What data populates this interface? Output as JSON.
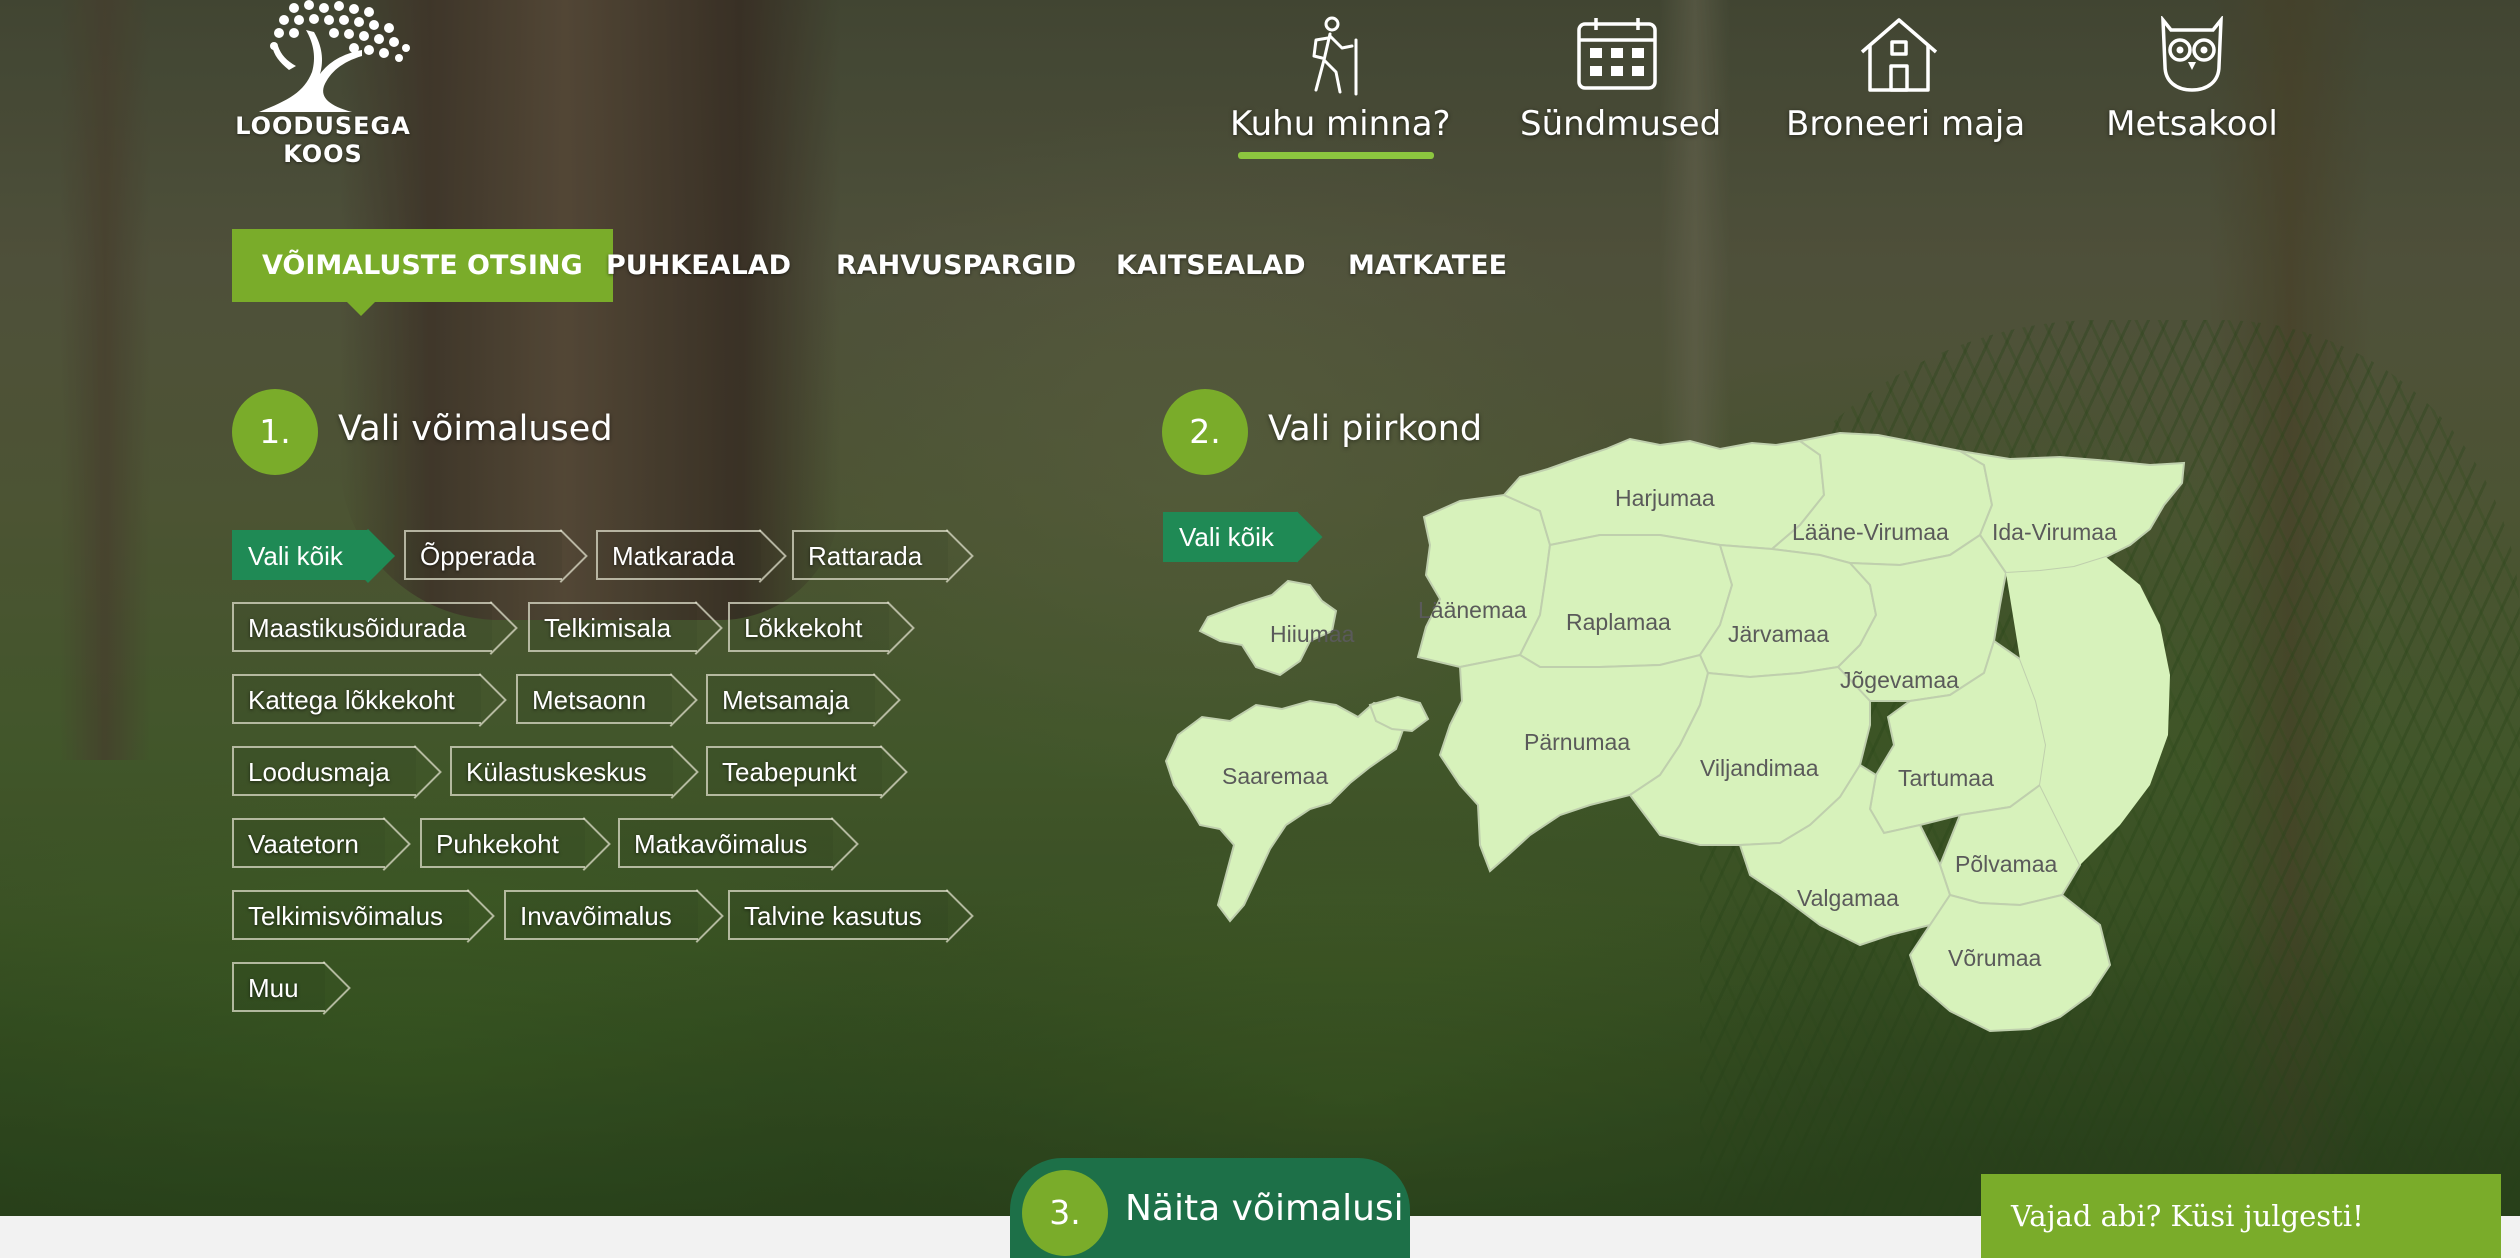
{
  "logo": {
    "line1": "LOODUSEGA",
    "line2": "KOOS"
  },
  "main_nav": [
    {
      "label": "Kuhu minna?",
      "icon": "hiker-icon",
      "active": true
    },
    {
      "label": "Sündmused",
      "icon": "calendar-icon",
      "active": false
    },
    {
      "label": "Broneeri maja",
      "icon": "house-icon",
      "active": false
    },
    {
      "label": "Metsakool",
      "icon": "owl-icon",
      "active": false
    }
  ],
  "sub_nav": [
    {
      "label": "VÕIMALUSTE OTSING",
      "active": true
    },
    {
      "label": "PUHKEALAD",
      "active": false
    },
    {
      "label": "RAHVUSPARGID",
      "active": false
    },
    {
      "label": "KAITSEALAD",
      "active": false
    },
    {
      "label": "MATKATEE",
      "active": false
    }
  ],
  "step1": {
    "number": "1.",
    "title": "Vali võimalused"
  },
  "step2": {
    "number": "2.",
    "title": "Vali piirkond"
  },
  "step3": {
    "number": "3.",
    "label": "Näita võimalusi"
  },
  "opportunities": {
    "rows": [
      [
        "Vali kõik",
        "Õpperada",
        "Matkarada",
        "Rattarada"
      ],
      [
        "Maastikusõidurada",
        "Telkimisala",
        "Lõkkekoht"
      ],
      [
        "Kattega lõkkekoht",
        "Metsaonn",
        "Metsamaja"
      ],
      [
        "Loodusmaja",
        "Külastuskeskus",
        "Teabepunkt"
      ],
      [
        "Vaatetorn",
        "Puhkekoht",
        "Matkavõimalus"
      ],
      [
        "Telkimisvõimalus",
        "Invavõimalus",
        "Talvine kasutus"
      ],
      [
        "Muu"
      ]
    ],
    "selected": "Vali kõik"
  },
  "map": {
    "select_all": "Vali kõik",
    "regions": {
      "harjumaa": "Harjumaa",
      "laane_virumaa": "Lääne-Virumaa",
      "ida_virumaa": "Ida-Virumaa",
      "laanemaa": "Läänemaa",
      "raplamaa": "Raplamaa",
      "jarvamaa": "Järvamaa",
      "hiiumaa": "Hiiumaa",
      "jogevamaa": "Jõgevamaa",
      "parnumaa": "Pärnumaa",
      "viljandimaa": "Viljandimaa",
      "saaremaa": "Saaremaa",
      "tartumaa": "Tartumaa",
      "polvamaa": "Põlvamaa",
      "valgamaa": "Valgamaa",
      "vorumaa": "Võrumaa"
    },
    "fill_color": "#d7f2bb"
  },
  "help": {
    "label": "Vajad abi? Küsi julgesti!"
  },
  "colors": {
    "accent_green": "#7aac2a",
    "selected_tag": "#1f8a55",
    "show_button": "#1d7048",
    "active_underline": "#8cc63f"
  }
}
